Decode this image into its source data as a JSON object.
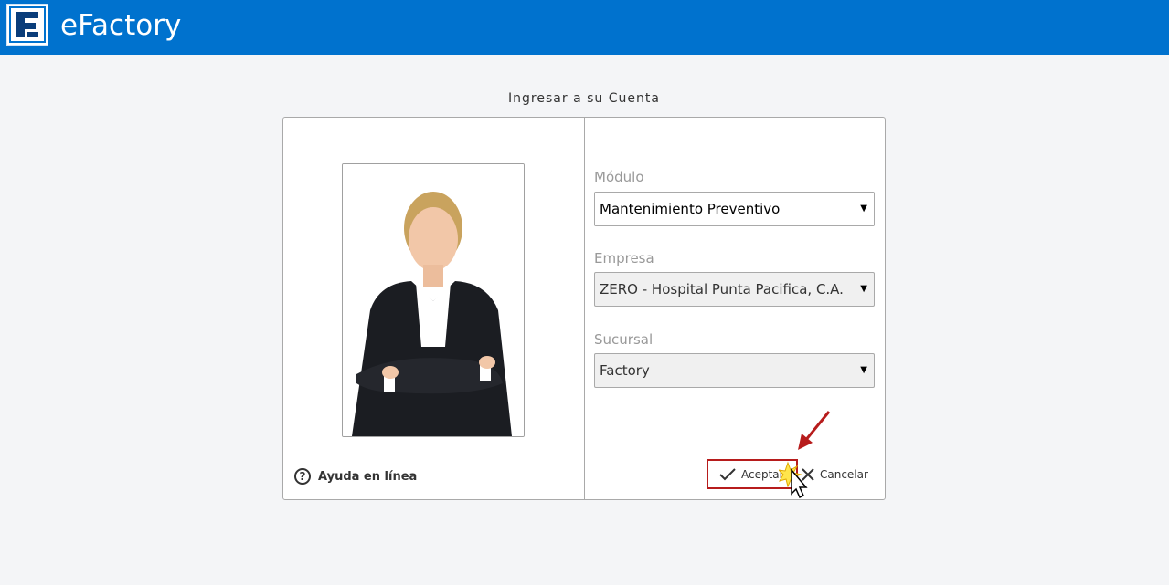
{
  "header": {
    "app_title": "eFactory",
    "logo_icon": "efactory-logo-icon",
    "bg_color": "#0072ce"
  },
  "login": {
    "title": "Ingresar a su Cuenta",
    "help_label": "Ayuda en línea",
    "help_icon": "question-circle-icon",
    "fields": {
      "modulo": {
        "label": "Módulo",
        "value": "Mantenimiento Preventivo"
      },
      "empresa": {
        "label": "Empresa",
        "value": "ZERO - Hospital Punta Pacifica, C.A."
      },
      "sucursal": {
        "label": "Sucursal",
        "value": "Factory"
      }
    },
    "buttons": {
      "accept_label": "Aceptar",
      "cancel_label": "Cancelar"
    }
  },
  "colors": {
    "highlight": "#b71c1c",
    "arrow": "#b71c1c"
  }
}
